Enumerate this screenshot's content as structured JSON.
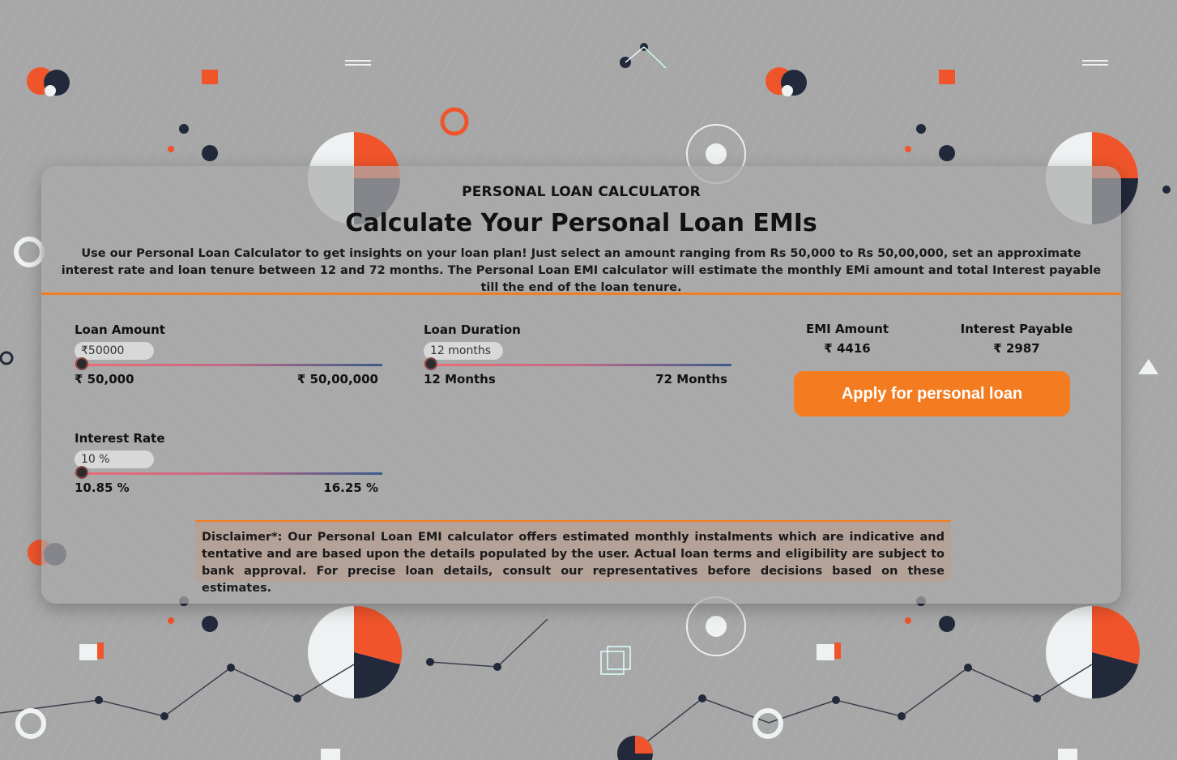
{
  "header": {
    "overline": "PERSONAL LOAN CALCULATOR",
    "title": "Calculate Your Personal Loan EMIs",
    "description": "Use our Personal Loan Calculator to get insights on your loan plan! Just select an amount ranging from Rs 50,000 to Rs 50,00,000, set an approximate interest rate and loan tenure between 12 and 72 months. The Personal Loan EMI calculator will estimate the monthly EMi amount and total Interest payable till the end of the loan tenure."
  },
  "loan_amount": {
    "label": "Loan Amount",
    "value": "₹50000",
    "min_label": "₹ 50,000",
    "max_label": "₹ 50,00,000",
    "slider_position": 0
  },
  "loan_duration": {
    "label": "Loan Duration",
    "value": "12 months",
    "min_label": "12 Months",
    "max_label": "72 Months",
    "slider_position": 0
  },
  "interest_rate": {
    "label": "Interest Rate",
    "value": "10 %",
    "min_label": "10.85 %",
    "max_label": "16.25 %",
    "slider_position": 0
  },
  "results": {
    "emi_label": "EMI Amount",
    "emi_value": "₹ 4416",
    "interest_label": "Interest Payable",
    "interest_value": "₹ 2987"
  },
  "apply_button": "Apply for personal loan",
  "disclaimer": "Disclaimer*: Our Personal Loan EMI calculator offers estimated monthly instalments which are indicative and tentative and are based upon the details populated by the user. Actual loan terms and eligibility are subject to bank approval. For precise loan details, consult our representatives before decisions based on these estimates.",
  "colors": {
    "accent": "#f47c20",
    "slider_start": "#f06a74",
    "slider_end": "#3b5a8c"
  }
}
